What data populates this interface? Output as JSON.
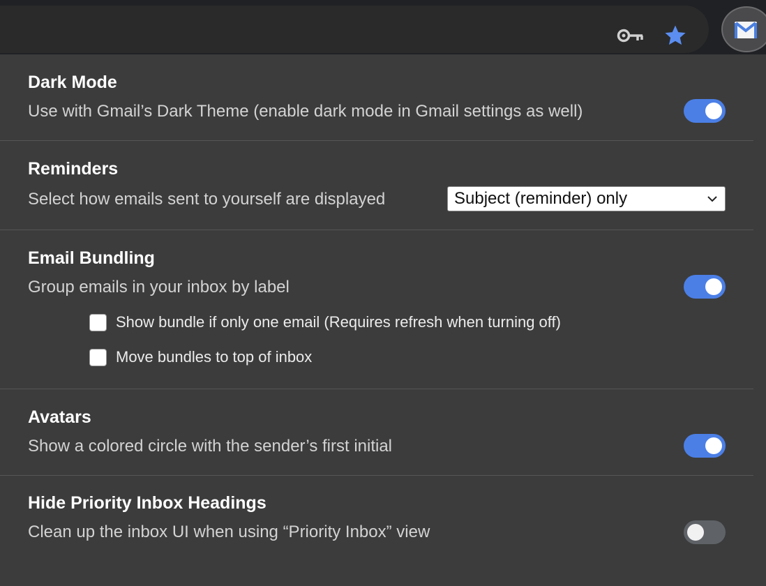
{
  "browser": {
    "icons": [
      "key-icon",
      "star-icon",
      "gmail-extension-icon"
    ],
    "colors": {
      "bar": "#202124",
      "url_bar": "#2a2a2b",
      "star": "#5b8ef0"
    }
  },
  "settings": {
    "dark_mode": {
      "title": "Dark Mode",
      "description": "Use with Gmail’s Dark Theme (enable dark mode in Gmail settings as well)",
      "enabled": true
    },
    "reminders": {
      "title": "Reminders",
      "description": "Select how emails sent to yourself are displayed",
      "selected": "Subject (reminder) only"
    },
    "email_bundling": {
      "title": "Email Bundling",
      "description": "Group emails in your inbox by label",
      "enabled": true,
      "options": [
        {
          "label": "Show bundle if only one email (Requires refresh when turning off)",
          "checked": false
        },
        {
          "label": "Move bundles to top of inbox",
          "checked": false
        }
      ]
    },
    "avatars": {
      "title": "Avatars",
      "description": "Show a colored circle with the sender’s first initial",
      "enabled": true
    },
    "priority_inbox": {
      "title": "Hide Priority Inbox Headings",
      "description": "Clean up the inbox UI when using “Priority Inbox” view",
      "enabled": false
    }
  },
  "colors": {
    "panel": "#3c3c3c",
    "toggle_on": "#4b7fe6",
    "toggle_off": "#5f6368",
    "divider": "#565656"
  }
}
